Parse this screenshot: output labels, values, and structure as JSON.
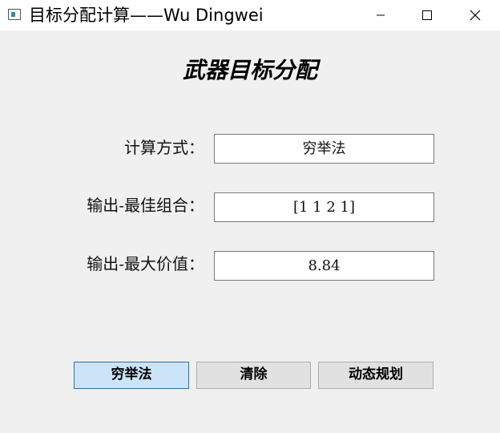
{
  "window": {
    "title": "目标分配计算——Wu Dingwei",
    "icon": "app-window-icon",
    "controls": [
      "minimize-icon",
      "maximize-icon",
      "close-icon"
    ]
  },
  "main": {
    "heading": "武器目标分配",
    "rows": [
      {
        "label": "计算方式：",
        "value": "穷举法"
      },
      {
        "label": "输出-最佳组合：",
        "value": "[1 1 2 1]"
      },
      {
        "label": "输出-最大价值：",
        "value": "8.84"
      }
    ]
  },
  "buttons": {
    "exhaustive": "穷举法",
    "clear": "清除",
    "dynamic": "动态规划"
  },
  "colors": {
    "background": "#f0f0f0",
    "primary_button_bg": "#cce4f7",
    "primary_button_border": "#2a6eb5"
  }
}
